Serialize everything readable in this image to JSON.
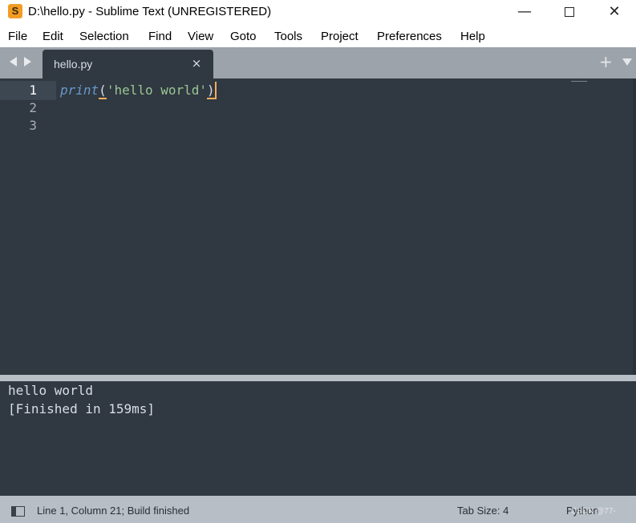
{
  "window": {
    "title": "D:\\hello.py - Sublime Text (UNREGISTERED)",
    "app_icon_glyph": "S",
    "app_icon_color": "#f29c24",
    "controls": {
      "minimize": "—",
      "close": "✕"
    }
  },
  "menu": {
    "items": [
      "File",
      "Edit",
      "Selection",
      "Find",
      "View",
      "Goto",
      "Tools",
      "Project",
      "Preferences",
      "Help"
    ]
  },
  "tabs": {
    "active": {
      "label": "hello.py",
      "close_glyph": "×"
    },
    "new_tab_glyph": "+"
  },
  "editor": {
    "line_numbers": [
      "1",
      "2",
      "3"
    ],
    "code_tokens": {
      "func": "print",
      "open_paren": "(",
      "string": "'hello world'",
      "close_paren": ")"
    },
    "colors": {
      "background": "#303841",
      "function": "#6699cc",
      "string": "#99c794",
      "cursor": "#f9ae58"
    }
  },
  "output": {
    "lines": [
      "hello world",
      "[Finished in 159ms]"
    ]
  },
  "status": {
    "position": "Line 1, Column 21; Build finished",
    "tab_size": "Tab Size: 4",
    "syntax": "Python",
    "watermark": "CSDN @77-"
  }
}
